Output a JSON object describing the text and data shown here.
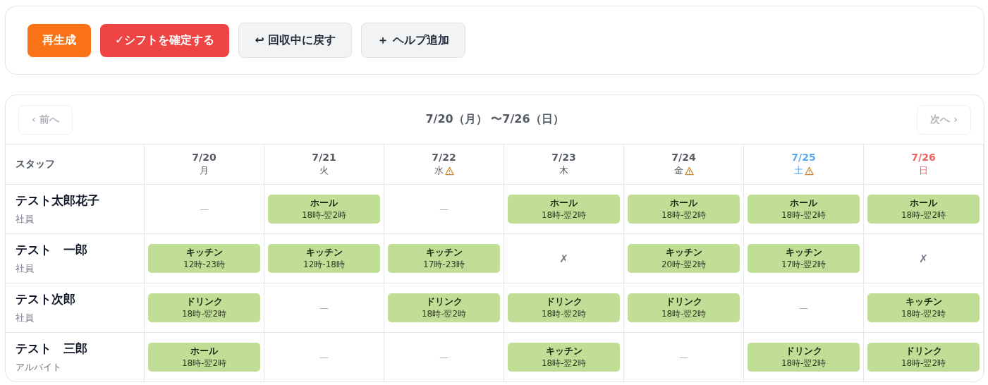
{
  "toolbar": {
    "buttons": [
      {
        "label": "再生成",
        "kind": "regenerate"
      },
      {
        "label": "✓シフトを確定する",
        "kind": "confirm"
      },
      {
        "label": "↩ 回収中に戻す",
        "kind": "secondary"
      },
      {
        "label": "＋ ヘルプ追加",
        "kind": "secondary"
      }
    ]
  },
  "calendar": {
    "prev": {
      "label": "‹ 前へ",
      "disabled": true
    },
    "range": "7/20（月） 〜7/26（日）",
    "next": {
      "label": "次へ ›",
      "disabled": true
    },
    "staff_header": "スタッフ",
    "days": [
      {
        "date": "7/20",
        "weekday": "月",
        "kind": "weekday",
        "warning": false
      },
      {
        "date": "7/21",
        "weekday": "火",
        "kind": "weekday",
        "warning": false
      },
      {
        "date": "7/22",
        "weekday": "水",
        "kind": "weekday",
        "warning": true
      },
      {
        "date": "7/23",
        "weekday": "木",
        "kind": "weekday",
        "warning": false
      },
      {
        "date": "7/24",
        "weekday": "金",
        "kind": "weekday",
        "warning": true
      },
      {
        "date": "7/25",
        "weekday": "土",
        "kind": "saturday",
        "warning": true
      },
      {
        "date": "7/26",
        "weekday": "日",
        "kind": "sunday",
        "warning": false
      }
    ],
    "rows": [
      {
        "name": "テスト太郎花子",
        "role": "社員",
        "cells": [
          {
            "kind": "empty",
            "text": "—"
          },
          {
            "kind": "shift",
            "position": "ホール",
            "time": "18時-翌2時"
          },
          {
            "kind": "empty",
            "text": "—"
          },
          {
            "kind": "shift",
            "position": "ホール",
            "time": "18時-翌2時"
          },
          {
            "kind": "shift",
            "position": "ホール",
            "time": "18時-翌2時"
          },
          {
            "kind": "shift",
            "position": "ホール",
            "time": "18時-翌2時"
          },
          {
            "kind": "shift",
            "position": "ホール",
            "time": "18時-翌2時"
          }
        ]
      },
      {
        "name": "テスト　一郎",
        "role": "社員",
        "cells": [
          {
            "kind": "shift",
            "position": "キッチン",
            "time": "12時-23時"
          },
          {
            "kind": "shift",
            "position": "キッチン",
            "time": "12時-18時"
          },
          {
            "kind": "shift",
            "position": "キッチン",
            "time": "17時-23時"
          },
          {
            "kind": "off",
            "text": "✗"
          },
          {
            "kind": "shift",
            "position": "キッチン",
            "time": "20時-翌2時"
          },
          {
            "kind": "shift",
            "position": "キッチン",
            "time": "17時-翌2時"
          },
          {
            "kind": "off",
            "text": "✗"
          }
        ]
      },
      {
        "name": "テスト次郎",
        "role": "社員",
        "cells": [
          {
            "kind": "shift",
            "position": "ドリンク",
            "time": "18時-翌2時"
          },
          {
            "kind": "empty",
            "text": "—"
          },
          {
            "kind": "shift",
            "position": "ドリンク",
            "time": "18時-翌2時"
          },
          {
            "kind": "shift",
            "position": "ドリンク",
            "time": "18時-翌2時"
          },
          {
            "kind": "shift",
            "position": "ドリンク",
            "time": "18時-翌2時"
          },
          {
            "kind": "empty",
            "text": "—"
          },
          {
            "kind": "shift",
            "position": "キッチン",
            "time": "18時-翌2時"
          }
        ]
      },
      {
        "name": "テスト　三郎",
        "role": "アルバイト",
        "cells": [
          {
            "kind": "shift",
            "position": "ホール",
            "time": "18時-翌2時"
          },
          {
            "kind": "empty",
            "text": "—"
          },
          {
            "kind": "empty",
            "text": "—"
          },
          {
            "kind": "shift",
            "position": "キッチン",
            "time": "18時-翌2時"
          },
          {
            "kind": "empty",
            "text": "—"
          },
          {
            "kind": "shift",
            "position": "ドリンク",
            "time": "18時-翌2時"
          },
          {
            "kind": "shift",
            "position": "ドリンク",
            "time": "18時-翌2時"
          }
        ]
      }
    ]
  }
}
